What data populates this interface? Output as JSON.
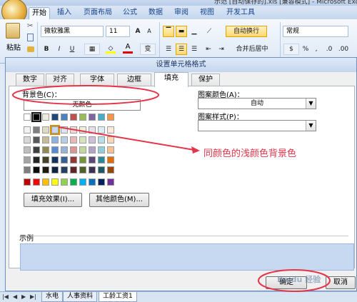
{
  "window": {
    "title": "示范 [自动保存的].xls  [兼容模式] - Microsoft Excel"
  },
  "ribbon": {
    "tabs": [
      "开始",
      "插入",
      "页面布局",
      "公式",
      "数据",
      "审阅",
      "视图",
      "开发工具"
    ],
    "active_tab": "开始",
    "font_name": "微软雅黑",
    "font_size": "11",
    "paste_label": "粘贴",
    "wrap_label": "自动换行",
    "merge_label": "合并后居中",
    "number_format": "常规",
    "bold": "B",
    "italic": "I",
    "underline": "U",
    "grow_font": "A",
    "shrink_font": "A",
    "font_color_glyph": "A",
    "percent": "%",
    "comma": ","
  },
  "dialog": {
    "title": "设置单元格格式",
    "tabs": [
      "数字",
      "对齐",
      "字体",
      "边框",
      "填充",
      "保护"
    ],
    "active_tab": "填充",
    "background_label": "背景色(C)：",
    "no_color": "无颜色",
    "fill_effects": "填充效果(I)...",
    "more_colors": "其他颜色(M)...",
    "pattern_color_label": "图案颜色(A)：",
    "pattern_color_value": "自动",
    "pattern_style_label": "图案样式(P)：",
    "pattern_style_value": "",
    "sample_label": "示例",
    "sample_color": "#c6d9f1",
    "ok": "确定",
    "cancel": "取消",
    "theme_top_row": [
      "#ffffff",
      "#000000",
      "#eeece1",
      "#1f497d",
      "#4f81bd",
      "#c0504d",
      "#9bbb59",
      "#8064a2",
      "#4bacc6",
      "#f79646"
    ],
    "theme_shades": [
      [
        "#f2f2f2",
        "#7f7f7f",
        "#ddd9c3",
        "#c6d9f0",
        "#dbe5f1",
        "#f2dcdb",
        "#ebf1dd",
        "#e5e0ec",
        "#dbeef3",
        "#fdeada"
      ],
      [
        "#d8d8d8",
        "#595959",
        "#c4bd97",
        "#8db3e2",
        "#b8cce4",
        "#e5b9b7",
        "#d7e3bc",
        "#ccc1d9",
        "#b7dde8",
        "#fbd5b5"
      ],
      [
        "#bfbfbf",
        "#3f3f3f",
        "#938953",
        "#548dd4",
        "#95b3d7",
        "#d99694",
        "#c3d69b",
        "#b2a2c7",
        "#92cddc",
        "#fac08f"
      ],
      [
        "#a5a5a5",
        "#262626",
        "#494429",
        "#17365d",
        "#366092",
        "#953734",
        "#76923c",
        "#5f497a",
        "#31859b",
        "#e36c09"
      ],
      [
        "#7f7f7f",
        "#0c0c0c",
        "#1d1b10",
        "#0f243e",
        "#244061",
        "#632423",
        "#4f6128",
        "#3f3151",
        "#205867",
        "#974806"
      ]
    ],
    "standard_colors": [
      "#c00000",
      "#ff0000",
      "#ffc000",
      "#ffff00",
      "#92d050",
      "#00b050",
      "#00b0f0",
      "#0070c0",
      "#002060",
      "#7030a0"
    ]
  },
  "sheet_tabs": [
    "水电",
    "人事资料",
    "工龄工资1"
  ],
  "annotation": {
    "text": "同颜色的浅颜色背景色",
    "color": "#e4344a"
  },
  "watermark": "Baidu 经验"
}
